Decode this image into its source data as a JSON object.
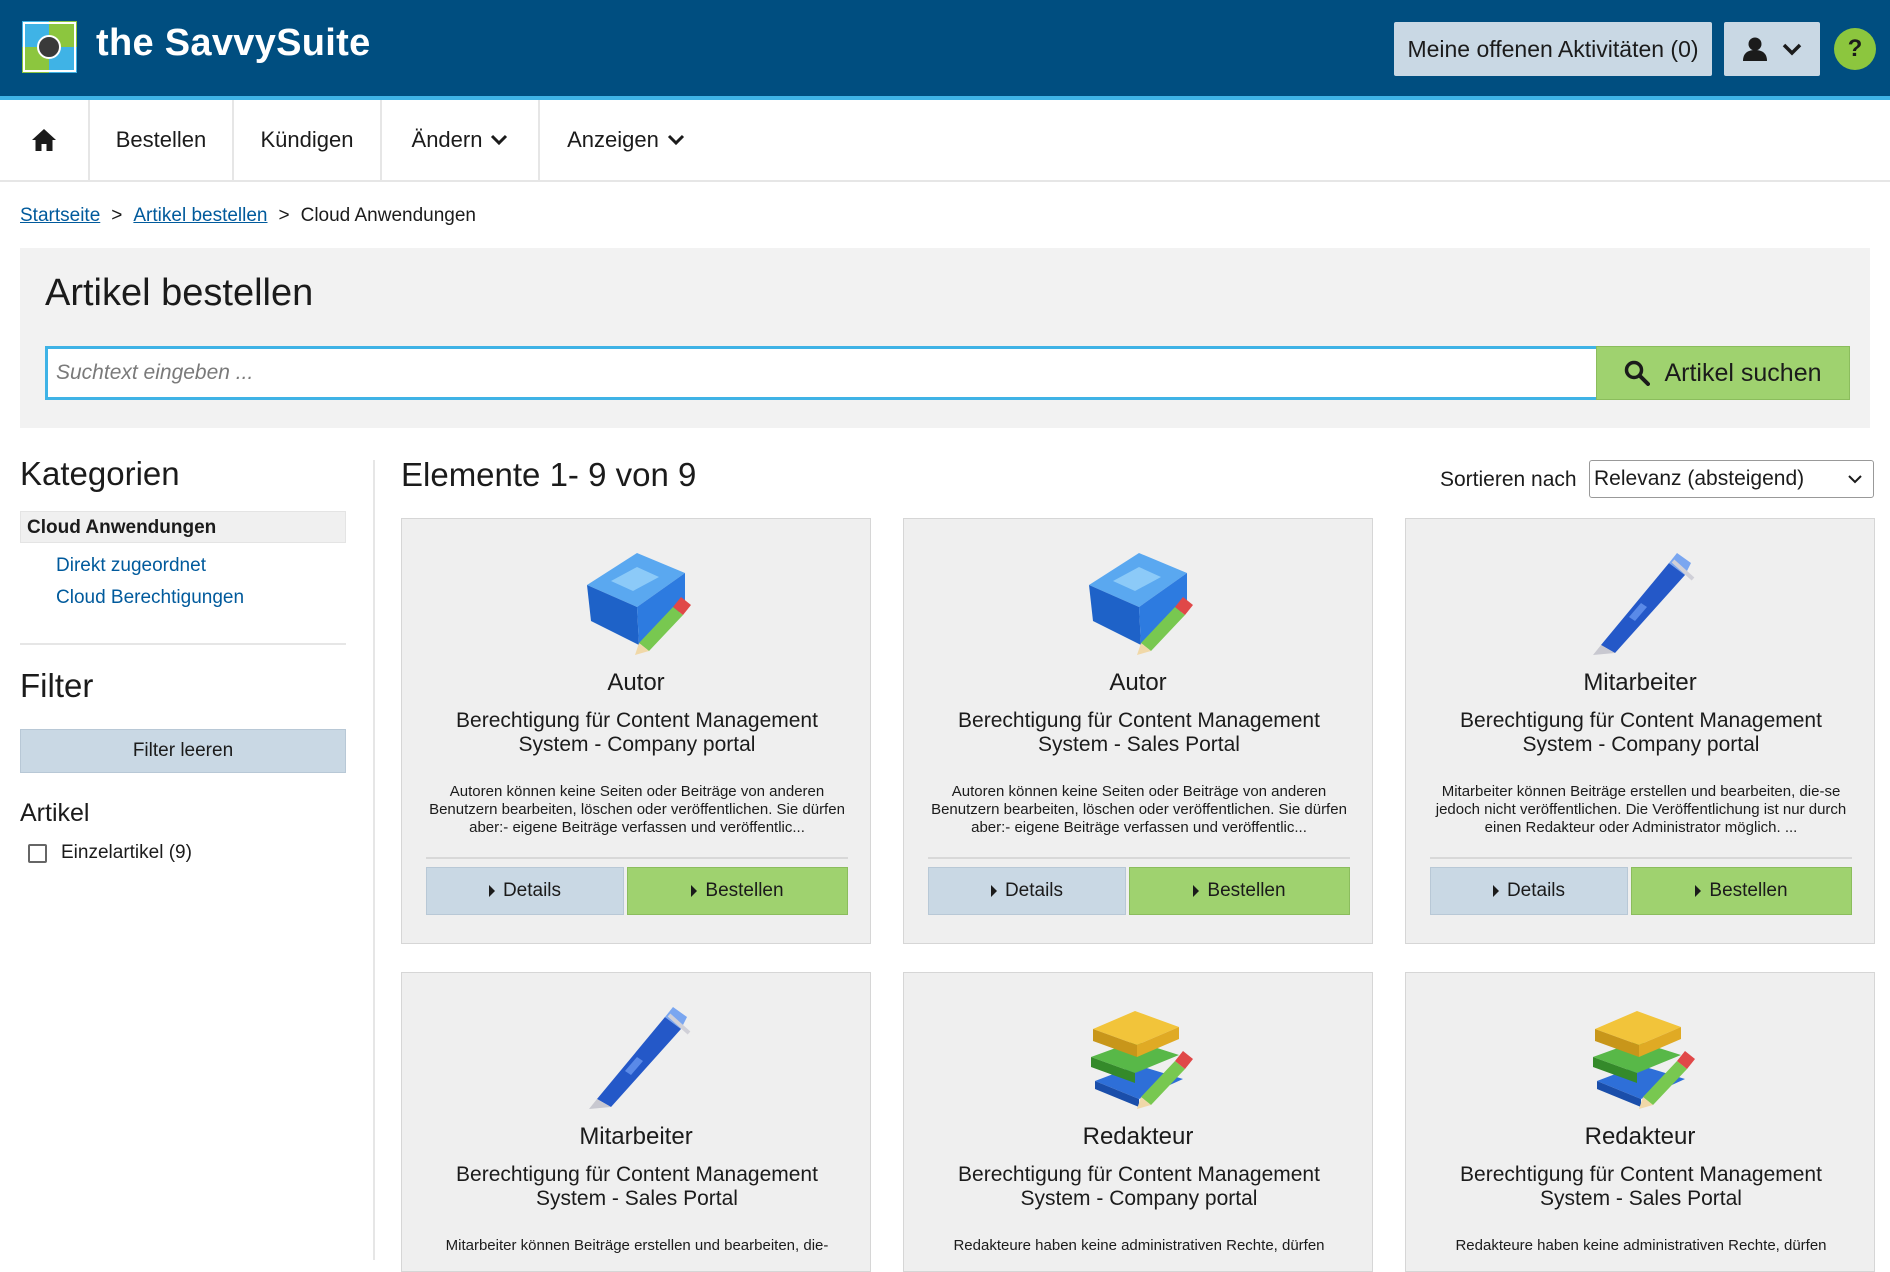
{
  "header": {
    "brand": "the SavvySuite",
    "activities_label": "Meine offenen Aktivitäten (0)",
    "help_label": "?"
  },
  "nav": {
    "items": [
      {
        "label": "Bestellen"
      },
      {
        "label": "Kündigen"
      },
      {
        "label": "Ändern"
      },
      {
        "label": "Anzeigen"
      }
    ]
  },
  "breadcrumb": {
    "items": [
      "Startseite",
      "Artikel bestellen",
      "Cloud Anwendungen"
    ],
    "separator": ">"
  },
  "search": {
    "title": "Artikel bestellen",
    "placeholder": "Suchtext eingeben ...",
    "value": "",
    "button_label": "Artikel suchen"
  },
  "sidebar": {
    "categories_title": "Kategorien",
    "active_category": "Cloud Anwendungen",
    "subcategories": [
      "Direkt zugeordnet",
      "Cloud Berechtigungen"
    ],
    "filter_title": "Filter",
    "filter_clear_label": "Filter leeren",
    "artikel_title": "Artikel",
    "checkbox_label": "Einzelartikel (9)"
  },
  "results": {
    "title": "Elemente 1- 9 von 9",
    "sort_label": "Sortieren nach",
    "sort_value": "Relevanz (absteigend)",
    "details_label": "Details",
    "order_label": "Bestellen",
    "cards": [
      {
        "title": "Autor",
        "sub_prefix": "Berechtigung für ",
        "sub_rest": "Content Management System - Company portal",
        "desc": "Autoren können keine Seiten oder Beiträge von anderen Benutzern bearbeiten, löschen oder veröffentlichen. Sie dürfen aber:- eigene Beiträge verfassen und veröffentlic...",
        "icon": "book-pencil-blue-icon"
      },
      {
        "title": "Autor",
        "sub_prefix": "Berechtigung für ",
        "sub_rest": "Content Management System - Sales Portal",
        "desc": "Autoren können keine Seiten oder Beiträge von anderen Benutzern bearbeiten, löschen oder veröffentlichen. Sie dürfen aber:- eigene Beiträge verfassen und veröffentlic...",
        "icon": "book-pencil-blue-icon"
      },
      {
        "title": "Mitarbeiter",
        "sub_prefix": "Berechtigung für ",
        "sub_rest": "Content Management System - Company portal",
        "desc": "Mitarbeiter können Beiträge erstellen und bearbeiten, die-se jedoch nicht veröffentlichen. Die Veröffentlichung ist nur durch einen Redakteur oder Administrator möglich. ...",
        "icon": "pen-icon"
      },
      {
        "title": "Mitarbeiter",
        "sub_prefix": "Berechtigung für ",
        "sub_rest": "Content Management System - Sales Portal",
        "desc": "Mitarbeiter können Beiträge erstellen und bearbeiten, die-",
        "icon": "pen-icon"
      },
      {
        "title": "Redakteur",
        "sub_prefix": "Berechtigung für ",
        "sub_rest": "Content Management System - Company portal",
        "desc": "Redakteure haben keine administrativen Rechte, dürfen",
        "icon": "books-pencil-icon"
      },
      {
        "title": "Redakteur",
        "sub_prefix": "Berechtigung für ",
        "sub_rest": "Content Management System - Sales Portal",
        "desc": "Redakteure haben keine administrativen Rechte, dürfen",
        "icon": "books-pencil-icon"
      }
    ]
  },
  "colors": {
    "header_bg": "#004e80",
    "accent_blue": "#3fb3e6",
    "green": "#9fd26f",
    "grey_button": "#c9d8e4",
    "link": "#005a9c"
  }
}
